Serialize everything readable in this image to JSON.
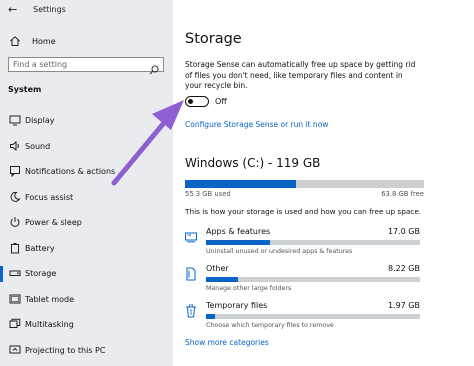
{
  "window": {
    "title": "Settings"
  },
  "sidebar": {
    "home_label": "Home",
    "search_placeholder": "Find a setting",
    "section_title": "System",
    "items": [
      {
        "label": "Display",
        "icon": "display-icon"
      },
      {
        "label": "Sound",
        "icon": "speaker-icon"
      },
      {
        "label": "Notifications & actions",
        "icon": "notifications-icon"
      },
      {
        "label": "Focus assist",
        "icon": "moon-icon"
      },
      {
        "label": "Power & sleep",
        "icon": "power-icon"
      },
      {
        "label": "Battery",
        "icon": "battery-icon"
      },
      {
        "label": "Storage",
        "icon": "storage-icon",
        "active": true
      },
      {
        "label": "Tablet mode",
        "icon": "tablet-icon"
      },
      {
        "label": "Multitasking",
        "icon": "multitasking-icon"
      },
      {
        "label": "Projecting to this PC",
        "icon": "projecting-icon"
      }
    ]
  },
  "main": {
    "heading": "Storage",
    "description": "Storage Sense can automatically free up space by getting rid of files you don't need, like temporary files and content in your recycle bin.",
    "toggle": {
      "state_label": "Off",
      "on": false
    },
    "configure_link": "Configure Storage Sense or run it now",
    "drive": {
      "title": "Windows (C:) - 119 GB",
      "used_label": "55.3 GB used",
      "free_label": "63.8 GB free",
      "used_fraction": 0.464
    },
    "usage_info": "This is how your storage is used and how you can free up space.",
    "categories": [
      {
        "name": "Apps & features",
        "size": "17.0 GB",
        "subtitle": "Uninstall unused or undesired apps & features",
        "fraction": 0.3,
        "icon": "apps-icon"
      },
      {
        "name": "Other",
        "size": "8.22 GB",
        "subtitle": "Manage other large folders",
        "fraction": 0.15,
        "icon": "other-files-icon"
      },
      {
        "name": "Temporary files",
        "size": "1.97 GB",
        "subtitle": "Choose which temporary files to remove",
        "fraction": 0.04,
        "icon": "trash-icon"
      }
    ],
    "show_more_link": "Show more categories"
  },
  "colors": {
    "accent": "#0a64c8",
    "sidebar_bg": "#e9ebee",
    "arrow": "#8e5fd0"
  }
}
